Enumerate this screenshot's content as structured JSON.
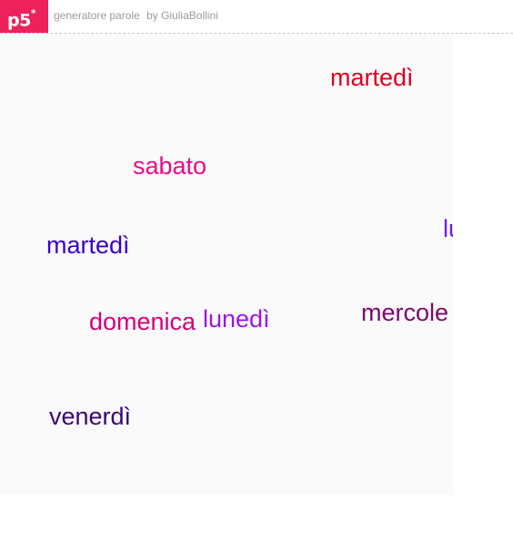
{
  "header": {
    "logo_text": "p5",
    "logo_mark": "*",
    "sketch_name": "generatore parole",
    "author": "by GiuliaBollini"
  },
  "canvas": {
    "background": "#fafafa",
    "words": [
      {
        "text": "martedì",
        "color": "#e0001f"
      },
      {
        "text": "sabato",
        "color": "#ea0a8c"
      },
      {
        "text": "martedì",
        "color": "#3a00c8"
      },
      {
        "text": "lu",
        "color": "#6a1cf0"
      },
      {
        "text": "domenica",
        "color": "#d40080"
      },
      {
        "text": "lunedì",
        "color": "#9a18e0"
      },
      {
        "text": "mercole",
        "color": "#7a0870"
      },
      {
        "text": "venerdì",
        "color": "#3a0870"
      }
    ]
  },
  "colors": {
    "brand": "#ed225d"
  }
}
